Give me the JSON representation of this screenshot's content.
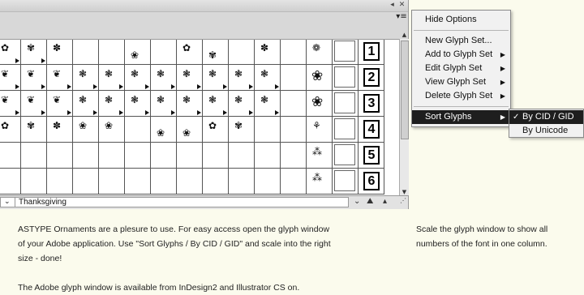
{
  "panel": {
    "font_name": "Thanksgiving",
    "menu_button_icon": "≡",
    "glyph_digits": [
      "1",
      "2",
      "3",
      "4",
      "5",
      "6"
    ]
  },
  "menu": {
    "hide_options": "Hide Options",
    "items": [
      {
        "label": "New Glyph Set...",
        "has_submenu": false
      },
      {
        "label": "Add to Glyph Set",
        "has_submenu": true
      },
      {
        "label": "Edit Glyph Set",
        "has_submenu": true
      },
      {
        "label": "View Glyph Set",
        "has_submenu": true
      },
      {
        "label": "Delete Glyph Set",
        "has_submenu": true
      }
    ],
    "sort_glyphs": "Sort Glyphs"
  },
  "submenu": {
    "by_cid": "By CID / GID",
    "by_unicode": "By Unicode",
    "selected": "By CID / GID"
  },
  "description": {
    "left_line1": "ASTYPE Ornaments are a plesure to use. For easy access open the glyph window",
    "left_line2": "of your Adobe application.  Use \"Sort Glyphs / By CID / GID\" and scale into the right",
    "left_line3": "size - done!",
    "left_line4": "The Adobe glyph window is available from InDesign2 and Illustrator CS on.",
    "right_line1": "Scale the glyph window to show all",
    "right_line2": "numbers of the font in one column."
  },
  "colors": {
    "background": "#fbfbed",
    "menu_highlight": "#1e1e1e"
  }
}
